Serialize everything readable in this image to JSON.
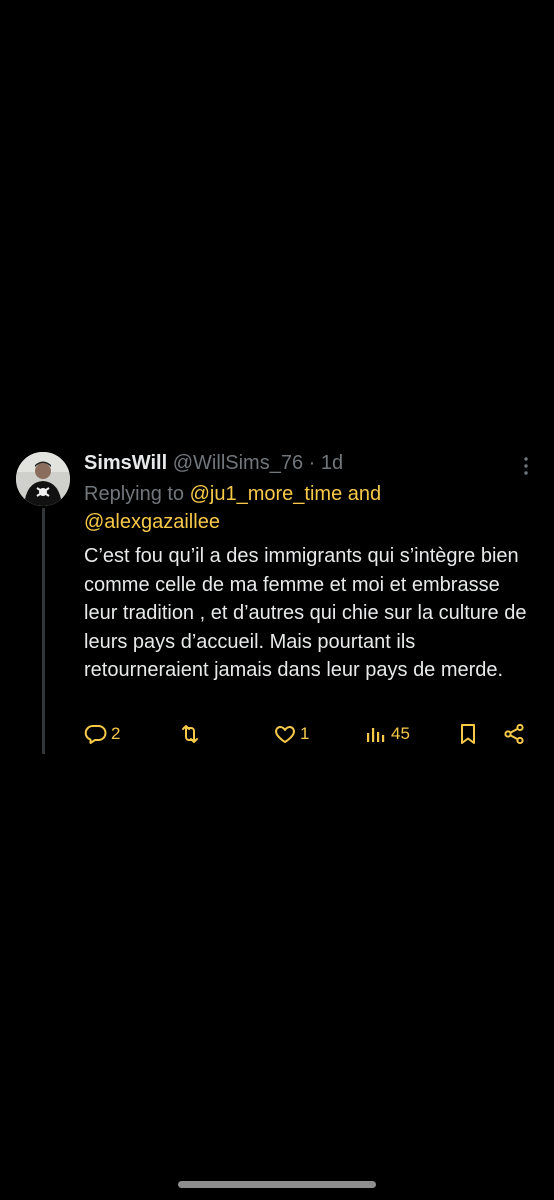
{
  "tweet": {
    "display_name": "SimsWill",
    "handle": "@WillSims_76",
    "separator": "·",
    "time": "1d",
    "replying_prefix": "Replying to",
    "replying_user1": "@ju1_more_time",
    "replying_and": "and",
    "replying_user2": "@alexgazaillee",
    "text": "C’est fou qu’il a des immigrants qui s’intègre bien comme celle de ma femme et moi et embrasse leur tradition , et d’autres qui chie sur la culture de leurs pays d’accueil. Mais pourtant ils retourneraient jamais dans leur pays de merde."
  },
  "actions": {
    "reply_count": "2",
    "retweet_count": "",
    "like_count": "1",
    "views_count": "45"
  },
  "icons": {
    "more": "more-vertical-icon",
    "reply": "reply-bubble-icon",
    "retweet": "retweet-icon",
    "like": "heart-icon",
    "views": "analytics-bars-icon",
    "bookmark": "bookmark-icon",
    "share": "share-icon"
  },
  "colors": {
    "background": "#000000",
    "accent": "#f7c948",
    "primary_text": "#e7e9ea",
    "secondary_text": "#71767b"
  }
}
